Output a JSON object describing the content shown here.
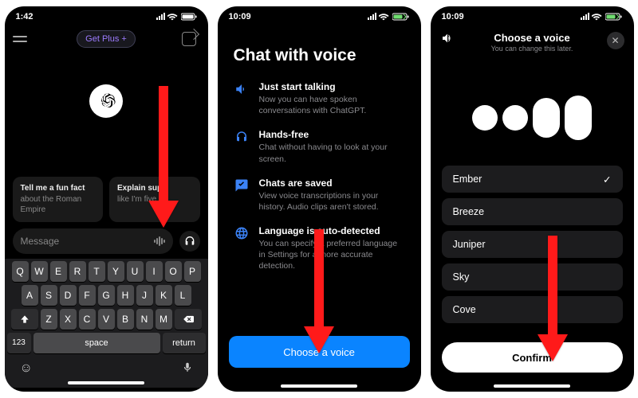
{
  "screen1": {
    "time": "1:42",
    "get_plus": "Get Plus +",
    "chip1_title": "Tell me a fun fact",
    "chip1_sub": "about the Roman Empire",
    "chip2_title": "Explain supe",
    "chip2_sub": "like I'm five ye",
    "message_placeholder": "Message",
    "keys_row1": [
      "Q",
      "W",
      "E",
      "R",
      "T",
      "Y",
      "U",
      "I",
      "O",
      "P"
    ],
    "keys_row2": [
      "A",
      "S",
      "D",
      "F",
      "G",
      "H",
      "J",
      "K",
      "L"
    ],
    "keys_row3": [
      "Z",
      "X",
      "C",
      "V",
      "B",
      "N",
      "M"
    ],
    "key_123": "123",
    "key_space": "space",
    "key_return": "return"
  },
  "screen2": {
    "time": "10:09",
    "heading": "Chat with voice",
    "features": [
      {
        "title": "Just start talking",
        "sub": "Now you can have spoken conversations with ChatGPT."
      },
      {
        "title": "Hands-free",
        "sub": "Chat without having to look at your screen."
      },
      {
        "title": "Chats are saved",
        "sub": "View voice transcriptions in your history. Audio clips aren't stored."
      },
      {
        "title": "Language is auto-detected",
        "sub": "You can specify a preferred language in Settings for a more accurate detection."
      }
    ],
    "choose_label": "Choose a voice"
  },
  "screen3": {
    "time": "10:09",
    "title": "Choose a voice",
    "subtitle": "You can change this later.",
    "voices": [
      "Ember",
      "Breeze",
      "Juniper",
      "Sky",
      "Cove"
    ],
    "selected_index": 0,
    "confirm_label": "Confirm"
  }
}
